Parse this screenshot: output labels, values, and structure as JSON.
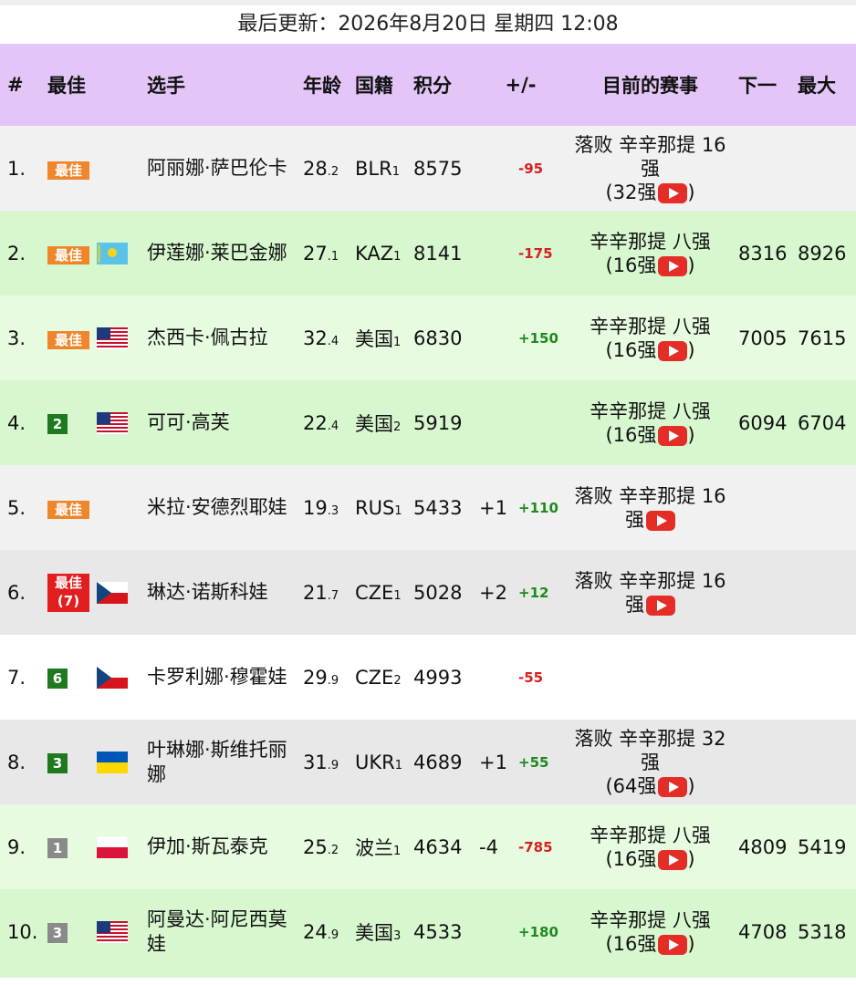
{
  "header": {
    "updated_label": "最后更新：2026年8月20日 星期四 12:08"
  },
  "columns": {
    "rank": "#",
    "best": "最佳",
    "player": "选手",
    "age": "年龄",
    "country": "国籍",
    "points": "积分",
    "change": "+/-",
    "current": "目前的赛事",
    "next": "下一",
    "max": "最大"
  },
  "colors": {
    "header_bg": "#e3c6f7",
    "row_green": "#d7f7cf",
    "row_gray": "#f1f1f1",
    "row_white": "#ffffff",
    "best_badge": "#f0862b",
    "negative": "#d81e1e",
    "positive": "#1e8a1e"
  },
  "rows": [
    {
      "rank": "1.",
      "best": "最佳",
      "best_type": "best",
      "flag": "none",
      "name": "阿丽娜·萨巴伦卡",
      "age": "28",
      "age_sub": ".2",
      "nat": "BLR",
      "nat_sub": "1",
      "points": "8575",
      "move": "",
      "delta": "-95",
      "event_lines": [
        "落败 辛辛那提 16",
        "强",
        "(32强"
      ],
      "event_tail": ")",
      "next": "",
      "max": "",
      "bg": "#f1f1f1"
    },
    {
      "rank": "2.",
      "best": "最佳",
      "best_type": "best",
      "flag": "kaz-flag",
      "name": "伊莲娜·莱巴金娜",
      "age": "27",
      "age_sub": ".1",
      "nat": "KAZ",
      "nat_sub": "1",
      "points": "8141",
      "move": "",
      "delta": "-175",
      "event_lines": [
        "辛辛那提 八强",
        "(16强"
      ],
      "event_tail": ")",
      "next": "8316",
      "max": "8926",
      "bg": "#d7f7cf"
    },
    {
      "rank": "3.",
      "best": "最佳",
      "best_type": "best",
      "flag": "usa-flag",
      "name": "杰西卡·佩古拉",
      "age": "32",
      "age_sub": ".4",
      "nat": "美国",
      "nat_sub": "1",
      "points": "6830",
      "move": "",
      "delta": "+150",
      "event_lines": [
        "辛辛那提 八强",
        "(16强"
      ],
      "event_tail": ")",
      "next": "7005",
      "max": "7615",
      "bg": "#e6fbdf"
    },
    {
      "rank": "4.",
      "best": "2",
      "best_type": "green",
      "flag": "usa-flag",
      "name": "可可·高芙",
      "age": "22",
      "age_sub": ".4",
      "nat": "美国",
      "nat_sub": "2",
      "points": "5919",
      "move": "",
      "delta": "",
      "event_lines": [
        "辛辛那提 八强",
        "(16强"
      ],
      "event_tail": ")",
      "next": "6094",
      "max": "6704",
      "bg": "#d7f7cf"
    },
    {
      "rank": "5.",
      "best": "最佳",
      "best_type": "best",
      "flag": "none",
      "name": "米拉·安德烈耶娃",
      "age": "19",
      "age_sub": ".3",
      "nat": "RUS",
      "nat_sub": "1",
      "points": "5433",
      "move": "+1",
      "delta": "+110",
      "event_lines": [
        "落败 辛辛那提 16",
        "强"
      ],
      "event_tail": "",
      "next": "",
      "max": "",
      "bg": "#f1f1f1"
    },
    {
      "rank": "6.",
      "best": "最佳",
      "best_sub": "(7)",
      "best_type": "red",
      "flag": "cze-flag",
      "name": "琳达·诺斯科娃",
      "age": "21",
      "age_sub": ".7",
      "nat": "CZE",
      "nat_sub": "1",
      "points": "5028",
      "move": "+2",
      "delta": "+12",
      "event_lines": [
        "落败 辛辛那提 16",
        "强"
      ],
      "event_tail": "",
      "next": "",
      "max": "",
      "bg": "#e8e8e8"
    },
    {
      "rank": "7.",
      "best": "6",
      "best_type": "green",
      "flag": "cze-flag",
      "name": "卡罗利娜·穆霍娃",
      "age": "29",
      "age_sub": ".9",
      "nat": "CZE",
      "nat_sub": "2",
      "points": "4993",
      "move": "",
      "delta": "-55",
      "event_lines": [],
      "event_tail": "",
      "next": "",
      "max": "",
      "bg": "#ffffff"
    },
    {
      "rank": "8.",
      "best": "3",
      "best_type": "green",
      "flag": "ukr-flag",
      "name": "叶琳娜·斯维托丽娜",
      "age": "31",
      "age_sub": ".9",
      "nat": "UKR",
      "nat_sub": "1",
      "points": "4689",
      "move": "+1",
      "delta": "+55",
      "event_lines": [
        "落败 辛辛那提 32",
        "强",
        "(64强"
      ],
      "event_tail": ")",
      "next": "",
      "max": "",
      "bg": "#e8e8e8"
    },
    {
      "rank": "9.",
      "best": "1",
      "best_type": "gray",
      "flag": "pol-flag",
      "name": "伊加·斯瓦泰克",
      "age": "25",
      "age_sub": ".2",
      "nat": "波兰",
      "nat_sub": "1",
      "points": "4634",
      "move": "-4",
      "delta": "-785",
      "event_lines": [
        "辛辛那提 八强",
        "(16强"
      ],
      "event_tail": ")",
      "next": "4809",
      "max": "5419",
      "bg": "#e6fbdf"
    },
    {
      "rank": "10.",
      "best": "3",
      "best_type": "gray",
      "flag": "usa-flag",
      "name": "阿曼达·阿尼西莫娃",
      "age": "24",
      "age_sub": ".9",
      "nat": "美国",
      "nat_sub": "3",
      "points": "4533",
      "move": "",
      "delta": "+180",
      "event_lines": [
        "辛辛那提 八强",
        "(16强"
      ],
      "event_tail": ")",
      "next": "4708",
      "max": "5318",
      "bg": "#d7f7cf"
    }
  ]
}
